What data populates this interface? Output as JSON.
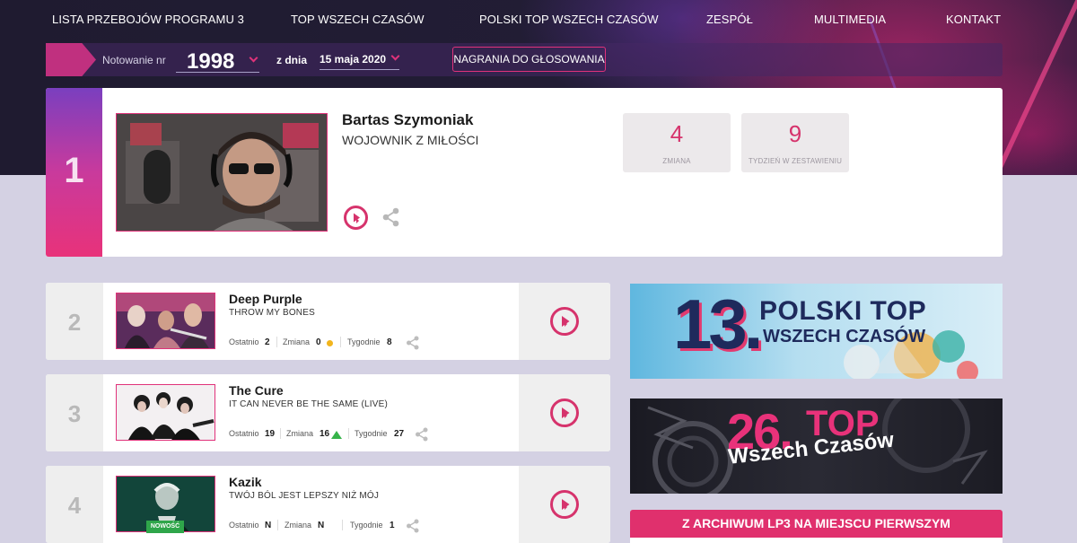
{
  "nav": {
    "items": [
      "LISTA PRZEBOJÓW PROGRAMU 3",
      "TOP WSZECH CZASÓW",
      "POLSKI TOP WSZECH CZASÓW",
      "ZESPÓŁ",
      "MULTIMEDIA",
      "KONTAKT"
    ]
  },
  "filter": {
    "notowanie_label": "Notowanie nr",
    "notowanie_value": "1998",
    "date_label": "z dnia",
    "date_value": "15 maja 2020",
    "vote_button": "NAGRANIA DO GŁOSOWANIA"
  },
  "top": {
    "rank": "1",
    "artist": "Bartas Szymoniak",
    "title": "WOJOWNIK Z MIŁOŚCI",
    "change_value": "4",
    "change_label": "ZMIANA",
    "weeks_value": "9",
    "weeks_label": "TYDZIEŃ W ZESTAWIENIU"
  },
  "labels": {
    "last": "Ostatnio",
    "change": "Zmiana",
    "weeks": "Tygodnie",
    "new_badge": "NOWOŚĆ"
  },
  "rows": [
    {
      "rank": "2",
      "artist": "Deep Purple",
      "title": "THROW MY BONES",
      "last": "2",
      "change": "0",
      "change_type": "same",
      "weeks": "8"
    },
    {
      "rank": "3",
      "artist": "The Cure",
      "title": "IT CAN NEVER BE THE SAME (LIVE)",
      "last": "19",
      "change": "16",
      "change_type": "up",
      "weeks": "27"
    },
    {
      "rank": "4",
      "artist": "Kazik",
      "title": "TWÓJ BÓL JEST LEPSZY NIŻ MÓJ",
      "last": "N",
      "change": "N",
      "change_type": "new",
      "weeks": "1"
    }
  ],
  "banners": {
    "b1_number": "13.",
    "b1_line1": "POLSKI TOP",
    "b1_line2": "WSZECH CZASÓW",
    "b2_number": "26.",
    "b2_line1": "TOP",
    "b2_line2": "Wszech Czasów",
    "archive_label": "Z ARCHIWUM LP3 NA MIEJSCU PIERWSZYM"
  },
  "colors": {
    "accent": "#e0306d",
    "up": "#36b34a",
    "same": "#f2b51d"
  }
}
